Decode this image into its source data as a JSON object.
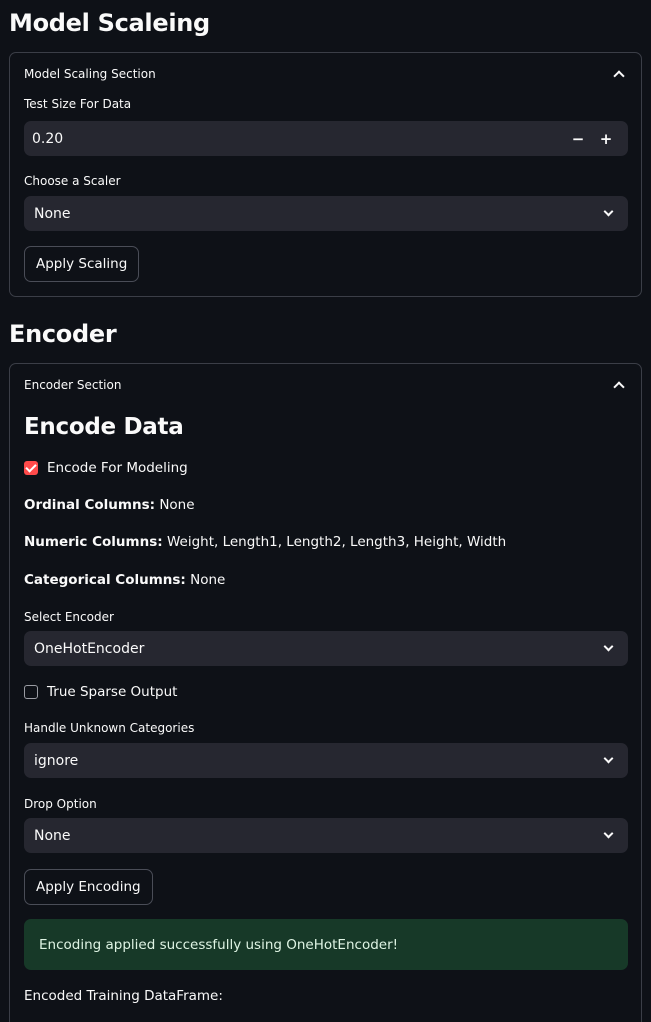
{
  "scaling": {
    "title": "Model Scaleing",
    "expander_label": "Model Scaling Section",
    "test_size_label": "Test Size For Data",
    "test_size_value": "0.20",
    "minus": "−",
    "plus": "+",
    "scaler_label": "Choose a Scaler",
    "scaler_value": "None",
    "apply_button": "Apply Scaling"
  },
  "encoder": {
    "title": "Encoder",
    "expander_label": "Encoder Section",
    "heading": "Encode Data",
    "encode_checkbox_label": "Encode For Modeling",
    "encode_checked": true,
    "ordinal_label": "Ordinal Columns:",
    "ordinal_value": "None",
    "numeric_label": "Numeric Columns:",
    "numeric_value": "Weight, Length1, Length2, Length3, Height, Width",
    "categorical_label": "Categorical Columns:",
    "categorical_value": "None",
    "select_encoder_label": "Select Encoder",
    "select_encoder_value": "OneHotEncoder",
    "sparse_checkbox_label": "True Sparse Output",
    "sparse_checked": false,
    "handle_unknown_label": "Handle Unknown Categories",
    "handle_unknown_value": "ignore",
    "drop_label": "Drop Option",
    "drop_value": "None",
    "apply_button": "Apply Encoding",
    "success_message": "Encoding applied successfully using OneHotEncoder!",
    "training_df_label": "Encoded Training DataFrame:"
  },
  "colors": {
    "background": "#0e1117",
    "input_bg": "#262730",
    "accent": "#ff4b4b",
    "success_bg": "#173928"
  },
  "icons": {
    "collapse": "chevron-up-icon",
    "dropdown": "chevron-down-icon",
    "check": "check-icon"
  }
}
